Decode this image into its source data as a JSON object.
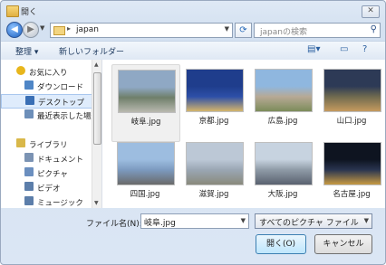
{
  "window": {
    "title": "開く",
    "close_icon": "close-icon"
  },
  "nav": {
    "address_path": "japan",
    "search_placeholder": "japanの検索"
  },
  "toolbar": {
    "organize_label": "整理 ▾",
    "new_folder_label": "新しいフォルダー"
  },
  "sidebar": {
    "items": [
      {
        "label": "お気に入り",
        "icon": "star-icon",
        "color": "#e8b61c",
        "indent": false,
        "selected": false
      },
      {
        "label": "ダウンロード",
        "icon": "download-folder-icon",
        "color": "#4f86c6",
        "indent": true,
        "selected": false
      },
      {
        "label": "デスクトップ",
        "icon": "desktop-icon",
        "color": "#3a6fb5",
        "indent": true,
        "selected": true
      },
      {
        "label": "最近表示した場所",
        "icon": "recent-places-icon",
        "color": "#6d8fb9",
        "indent": true,
        "selected": false
      },
      {
        "label": "ライブラリ",
        "icon": "library-icon",
        "color": "#d9b84a",
        "indent": false,
        "selected": false
      },
      {
        "label": "ドキュメント",
        "icon": "documents-icon",
        "color": "#7b93b3",
        "indent": true,
        "selected": false
      },
      {
        "label": "ピクチャ",
        "icon": "pictures-icon",
        "color": "#6b8fbf",
        "indent": true,
        "selected": false
      },
      {
        "label": "ビデオ",
        "icon": "videos-icon",
        "color": "#5c7eaa",
        "indent": true,
        "selected": false
      },
      {
        "label": "ミュージック",
        "icon": "music-icon",
        "color": "#5c7eaa",
        "indent": true,
        "selected": false
      }
    ]
  },
  "files": [
    {
      "name": "岐阜.jpg",
      "selected": true,
      "colors": [
        "#8fa8c4",
        "#6f7f6a",
        "#b9b9b0"
      ]
    },
    {
      "name": "京都.jpg",
      "selected": false,
      "colors": [
        "#1f3d8c",
        "#2d4fa8",
        "#d5b56a"
      ]
    },
    {
      "name": "広島.jpg",
      "selected": false,
      "colors": [
        "#8fb7df",
        "#b7a995",
        "#7c8c5a"
      ]
    },
    {
      "name": "山口.jpg",
      "selected": false,
      "colors": [
        "#2d3a56",
        "#6f6a4f",
        "#c59b5e"
      ]
    },
    {
      "name": "四国.jpg",
      "selected": false,
      "colors": [
        "#9dbde0",
        "#7c9abf",
        "#6a6a6a"
      ]
    },
    {
      "name": "滋賀.jpg",
      "selected": false,
      "colors": [
        "#bcc8d6",
        "#9aa6b3",
        "#8a8a7c"
      ]
    },
    {
      "name": "大阪.jpg",
      "selected": false,
      "colors": [
        "#c7d3e0",
        "#8e9aa6",
        "#5a6270"
      ]
    },
    {
      "name": "名古屋.jpg",
      "selected": false,
      "colors": [
        "#0e1420",
        "#2a3550",
        "#c79a42"
      ]
    }
  ],
  "bottom": {
    "filename_label": "ファイル名(N):",
    "filename_value": "岐阜.jpg",
    "filetype_value": "すべてのピクチャ ファイル",
    "open_label": "開く(O)",
    "cancel_label": "キャンセル"
  }
}
